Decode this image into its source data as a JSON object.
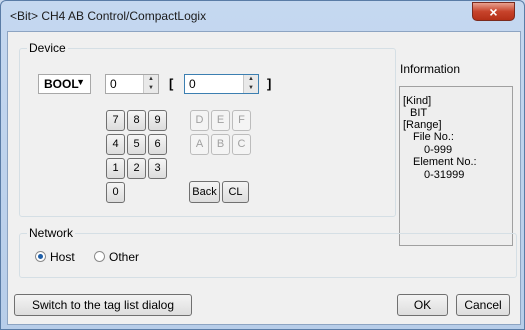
{
  "window": {
    "title": "<Bit> CH4 AB Control/CompactLogix",
    "close_symbol": "×"
  },
  "device": {
    "group_label": "Device",
    "type_value": "BOOL",
    "field1_value": "0",
    "field2_value": "0",
    "open_bracket": "[",
    "close_bracket": "]",
    "keypad": [
      "7",
      "8",
      "9",
      "4",
      "5",
      "6",
      "1",
      "2",
      "3",
      "0"
    ],
    "hex_keys": [
      "D",
      "E",
      "F",
      "A",
      "B",
      "C"
    ],
    "back_label": "Back",
    "clear_label": "CL"
  },
  "information": {
    "heading": "Information",
    "lines": [
      "[Kind]",
      "BIT",
      "[Range]",
      "File No.:",
      "0-999",
      "Element No.:",
      "0-31999"
    ]
  },
  "network": {
    "group_label": "Network",
    "host_label": "Host",
    "other_label": "Other",
    "selected": "Host"
  },
  "footer": {
    "switch_label": "Switch to the tag list dialog",
    "ok_label": "OK",
    "cancel_label": "Cancel"
  }
}
